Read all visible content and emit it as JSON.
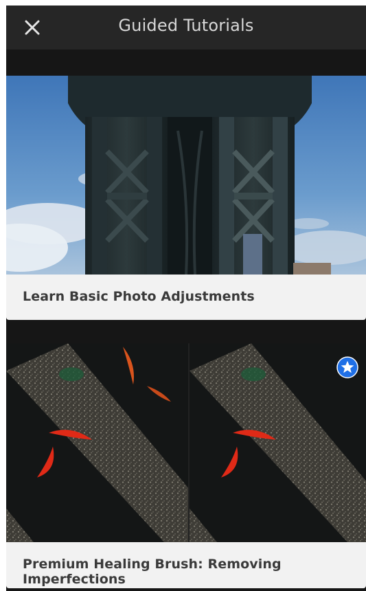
{
  "header": {
    "title": "Guided Tutorials",
    "close_icon": "close-icon"
  },
  "tutorials": [
    {
      "title": "Learn Basic Photo Adjustments",
      "image": "bridge-underside-photo",
      "premium": false
    },
    {
      "title": "Premium Healing Brush: Removing Imperfections",
      "image": "koi-fish-before-after-photo",
      "premium": true,
      "badge_icon": "star-badge-icon"
    }
  ],
  "colors": {
    "header_bg": "#262626",
    "screen_bg": "#161616",
    "caption_bg": "#f2f2f2",
    "caption_text": "#3a3a3a",
    "badge_blue": "#1f6fe6"
  }
}
